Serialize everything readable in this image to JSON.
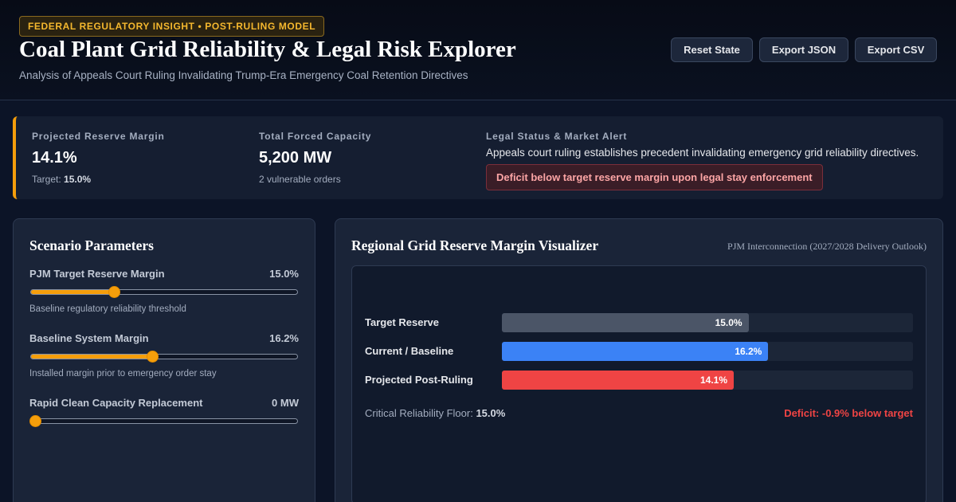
{
  "header": {
    "badge": "FEDERAL REGULATORY INSIGHT • POST-RULING MODEL",
    "title": "Coal Plant Grid Reliability & Legal Risk Explorer",
    "subtitle": "Analysis of Appeals Court Ruling Invalidating Trump-Era Emergency Coal Retention Directives",
    "buttons": {
      "reset": "Reset State",
      "export_json": "Export JSON",
      "export_csv": "Export CSV"
    }
  },
  "summary": {
    "reserve": {
      "label": "Projected Reserve Margin",
      "value": "14.1%",
      "target_label": "Target:",
      "target_value": "15.0%"
    },
    "capacity": {
      "label": "Total Forced Capacity",
      "value": "5,200 MW",
      "sub": "2 vulnerable orders"
    },
    "legal": {
      "label": "Legal Status & Market Alert",
      "text": "Appeals court ruling establishes precedent invalidating emergency grid reliability directives.",
      "alert": "Deficit below target reserve margin upon legal stay enforcement"
    }
  },
  "scenario": {
    "title": "Scenario Parameters",
    "params": [
      {
        "label": "PJM Target Reserve Margin",
        "value": "15.0%",
        "fraction": 0.31,
        "help": "Baseline regulatory reliability threshold"
      },
      {
        "label": "Baseline System Margin",
        "value": "16.2%",
        "fraction": 0.455,
        "help": "Installed margin prior to emergency order stay"
      },
      {
        "label": "Rapid Clean Capacity Replacement",
        "value": "0 MW",
        "fraction": 0.0,
        "help": ""
      }
    ]
  },
  "visualizer": {
    "title": "Regional Grid Reserve Margin Visualizer",
    "subtitle": "PJM Interconnection (2027/2028 Delivery Outlook)",
    "bars": [
      {
        "label": "Target Reserve",
        "value": 15.0,
        "display": "15.0%",
        "color": "#4b5567"
      },
      {
        "label": "Current / Baseline",
        "value": 16.2,
        "display": "16.2%",
        "color": "#3b82f6"
      },
      {
        "label": "Projected Post-Ruling",
        "value": 14.1,
        "display": "14.1%",
        "color": "#ef4444"
      }
    ],
    "scale_max": 25,
    "floor_label": "Critical Reliability Floor:",
    "floor_value": "15.0%",
    "deficit": "Deficit: -0.9% below target"
  }
}
